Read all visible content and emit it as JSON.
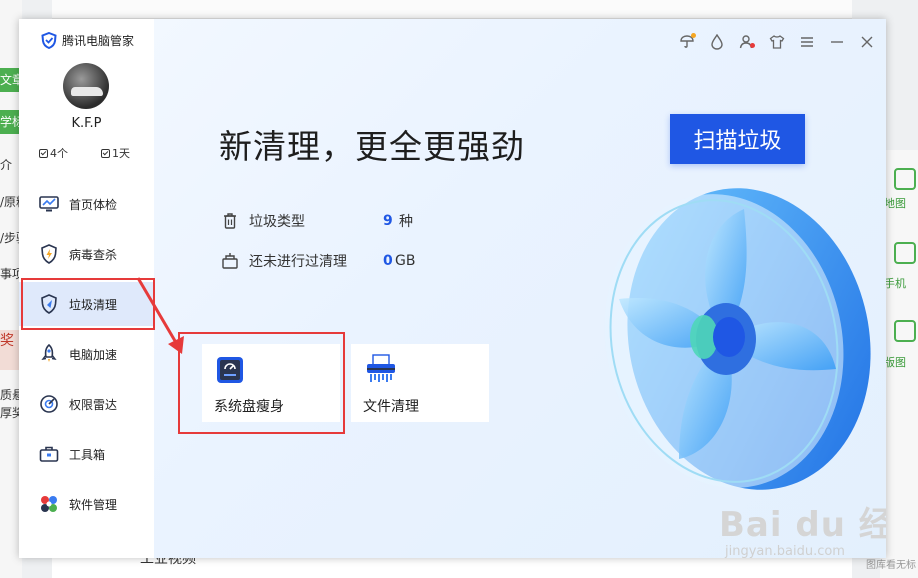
{
  "background": {
    "left_tags": [
      "文章",
      "学标"
    ],
    "left_lines": [
      "介",
      "/原料",
      "/步骤",
      "事项"
    ],
    "left_red": [
      "奖",
      "质悬",
      "厚奖"
    ],
    "right_items": [
      "地图",
      "手机",
      "版图"
    ],
    "bottom_text": "工业视频",
    "bottom_right": "图库看无标"
  },
  "app": {
    "name": "腾讯电脑管家",
    "user": {
      "name": "K.F.P",
      "count": "4个",
      "days": "1天"
    },
    "nav": [
      {
        "label": "首页体检",
        "icon": "monitor-icon"
      },
      {
        "label": "病毒查杀",
        "icon": "shield-bolt-icon"
      },
      {
        "label": "垃圾清理",
        "icon": "broom-shield-icon"
      },
      {
        "label": "电脑加速",
        "icon": "rocket-icon"
      },
      {
        "label": "权限雷达",
        "icon": "radar-icon"
      },
      {
        "label": "工具箱",
        "icon": "toolbox-icon"
      },
      {
        "label": "软件管理",
        "icon": "software-icon"
      }
    ],
    "active_nav": "垃圾清理",
    "window_controls": [
      "umbrella-icon",
      "drop-icon",
      "user-alert-icon",
      "shirt-icon",
      "menu-icon",
      "minimize-icon",
      "close-icon"
    ],
    "notify_color": "#f5a623",
    "alert_color": "#e63a3a"
  },
  "main": {
    "headline": "新清理，更全更强劲",
    "scan_button": "扫描垃圾",
    "junk_types_label": "垃圾类型",
    "junk_types_value": "9",
    "junk_types_unit": "种",
    "uncleaned_label": "还未进行过清理",
    "uncleaned_value": "0",
    "uncleaned_unit": "GB",
    "tools": [
      {
        "label": "系统盘瘦身",
        "icon": "disk-slim-icon"
      },
      {
        "label": "文件清理",
        "icon": "file-shredder-icon"
      }
    ],
    "accent": "#1f57e4",
    "highlight": "#e63a3a"
  },
  "watermark": {
    "main": "Bai du 经验",
    "sub": "jingyan.baidu.com"
  }
}
